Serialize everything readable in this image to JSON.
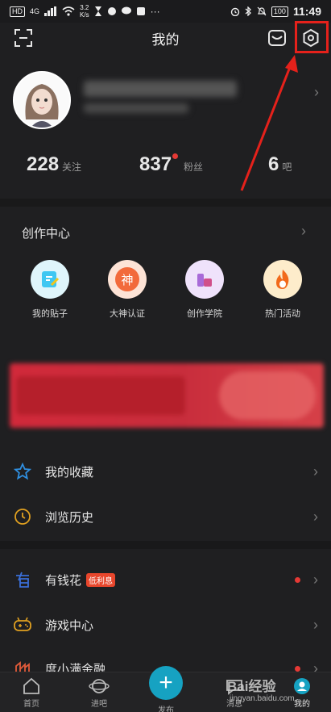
{
  "status_bar": {
    "network_left": "HD",
    "signal": "4G",
    "speed": "3.2",
    "speed_unit": "K/s",
    "more": "···",
    "battery": "100",
    "time": "11:49"
  },
  "header": {
    "title": "我的"
  },
  "stats": [
    {
      "value": "228",
      "label": "关注"
    },
    {
      "value": "837",
      "label": "粉丝"
    },
    {
      "value": "6",
      "label": "吧"
    }
  ],
  "creation_center": {
    "title": "创作中心",
    "items": [
      {
        "label": "我的贴子",
        "icon": "edit-icon",
        "color": "#3fc7f2"
      },
      {
        "label": "大神认证",
        "icon": "god-cert-icon",
        "glyph": "神",
        "color": "#f26a3b"
      },
      {
        "label": "创作学院",
        "icon": "academy-icon",
        "color": "#a86ad8"
      },
      {
        "label": "热门活动",
        "icon": "fire-icon",
        "color": "#f39a1e"
      }
    ]
  },
  "menu_group_1": [
    {
      "label": "我的收藏",
      "icon": "star-icon"
    },
    {
      "label": "浏览历史",
      "icon": "clock-icon"
    }
  ],
  "menu_group_2": [
    {
      "label": "有钱花",
      "icon": "money-icon",
      "badge": "低利息",
      "dot": true
    },
    {
      "label": "游戏中心",
      "icon": "gamepad-icon",
      "dot": false
    },
    {
      "label": "度小满金融",
      "icon": "finance-icon",
      "dot": true
    }
  ],
  "tabbar": [
    {
      "label": "首页",
      "icon": "home-icon"
    },
    {
      "label": "进吧",
      "icon": "planet-icon"
    },
    {
      "label": "发布",
      "icon": "plus-icon"
    },
    {
      "label": "消息",
      "icon": "message-icon"
    },
    {
      "label": "我的",
      "icon": "profile-icon"
    }
  ],
  "watermark": {
    "text": "Bai经验",
    "url": "jingyan.baidu.com"
  },
  "colors": {
    "background": "#1f1f21",
    "accent": "#16a2c2",
    "highlight": "#e5211b",
    "dot": "#e53935"
  }
}
